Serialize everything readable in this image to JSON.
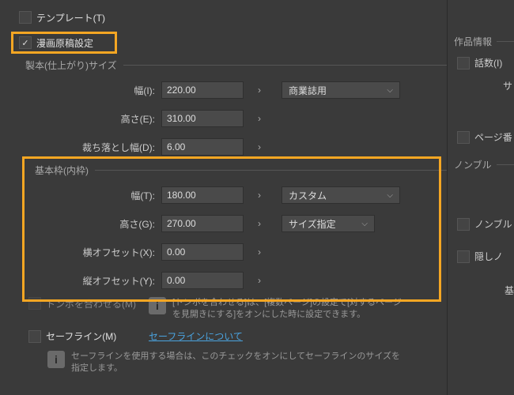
{
  "left": {
    "template_label": "テンプレート(T)",
    "manga_settings_label": "漫画原稿設定",
    "binding_section": "製本(仕上がり)サイズ",
    "width_i_label": "幅(I):",
    "width_i_value": "220.00",
    "height_e_label": "高さ(E):",
    "height_e_value": "310.00",
    "bleed_label": "裁ち落とし幅(D):",
    "bleed_value": "6.00",
    "preset_commercial": "商業誌用",
    "inner_section": "基本枠(内枠)",
    "width_t_label": "幅(T):",
    "width_t_value": "180.00",
    "height_g_label": "高さ(G):",
    "height_g_value": "270.00",
    "offset_x_label": "横オフセット(X):",
    "offset_x_value": "0.00",
    "offset_y_label": "縦オフセット(Y):",
    "offset_y_value": "0.00",
    "preset_custom": "カスタム",
    "preset_size": "サイズ指定",
    "tombo_label": "トンボを合わせる(M)",
    "tombo_info": "[トンボを合わせる]は、[複数ページ]の設定で[対するページを見開きにする]をオンにした時に設定できます。",
    "safeline_label": "セーフライン(M)",
    "safeline_link": "セーフラインについて",
    "safeline_info": "セーフラインを使用する場合は、このチェックをオンにしてセーフラインのサイズを指定します。"
  },
  "right": {
    "work_info": "作品情報",
    "episodes_label": "話数(I)",
    "sa_label": "サ",
    "page_num_label": "ページ番",
    "nombre_section": "ノンブル",
    "nombre_check": "ノンブル",
    "hidden_label": "隠しノ",
    "base_label": "基"
  }
}
